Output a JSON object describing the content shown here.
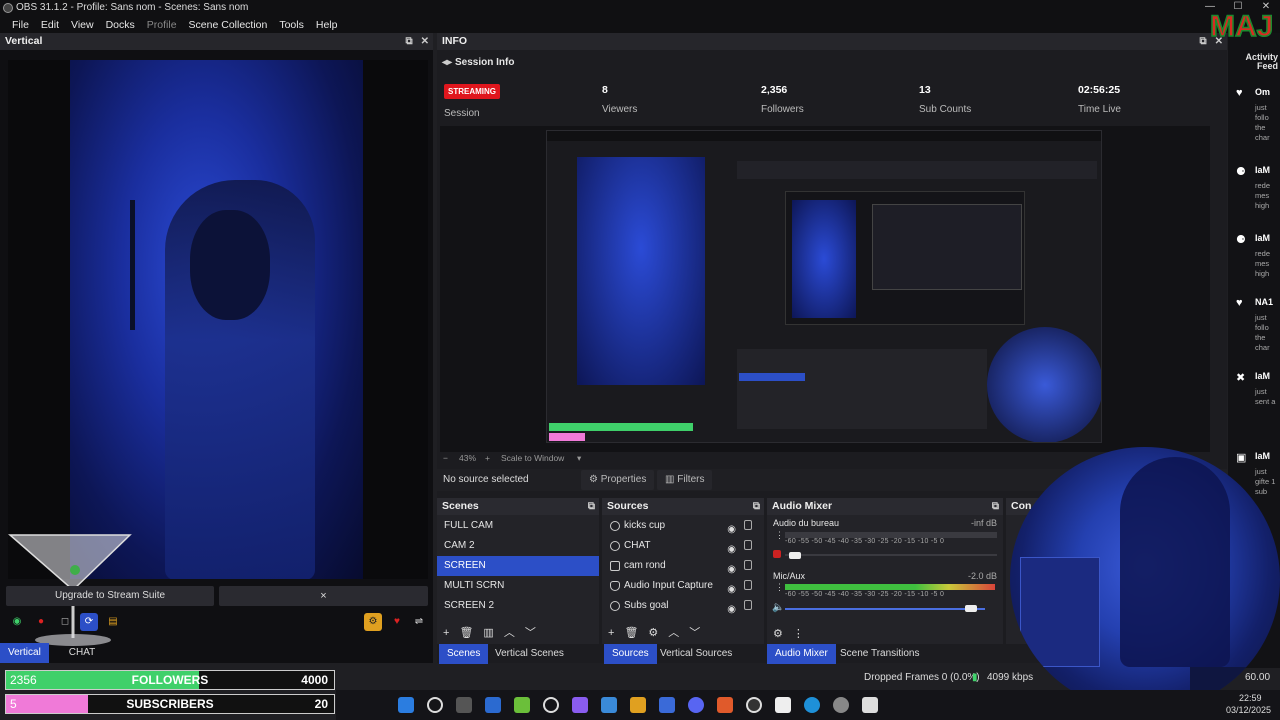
{
  "window": {
    "title": "OBS 31.1.2 - Profile: Sans nom - Scenes: Sans nom"
  },
  "menu": [
    "File",
    "Edit",
    "View",
    "Docks",
    "Profile",
    "Scene Collection",
    "Tools",
    "Help"
  ],
  "vertical": {
    "title": "Vertical",
    "upgrade_label": "Upgrade to Stream Suite",
    "close_label": "×",
    "tabs": [
      "Vertical",
      "CHAT"
    ]
  },
  "info": {
    "title": "INFO",
    "session_info": "Session Info",
    "status_badge": "STREAMING",
    "session_label": "Session",
    "stats": [
      {
        "value": "8",
        "label": "Viewers"
      },
      {
        "value": "2,356",
        "label": "Followers"
      },
      {
        "value": "13",
        "label": "Sub Counts"
      },
      {
        "value": "02:56:25",
        "label": "Time Live"
      }
    ]
  },
  "preview": {
    "zoom": "43%",
    "scale_label": "Scale to Window",
    "no_source": "No source selected",
    "properties_label": "Properties",
    "filters_label": "Filters"
  },
  "scenes": {
    "title": "Scenes",
    "items": [
      "FULL CAM",
      "CAM 2",
      "SCREEN",
      "MULTI SCRN",
      "SCREEN 2"
    ],
    "selected": "SCREEN"
  },
  "sources": {
    "title": "Sources",
    "items": [
      "kicks cup",
      "CHAT",
      "cam rond",
      "Audio Input Capture",
      "Subs goal"
    ]
  },
  "audio": {
    "title": "Audio Mixer",
    "channels": [
      {
        "name": "Audio du bureau",
        "db": "-inf dB",
        "level": 0.0
      },
      {
        "name": "Mic/Aux",
        "db": "-2.0 dB",
        "level": 0.98
      }
    ],
    "ticks": "-60 -55 -50 -45 -40 -35 -30 -25 -20 -15 -10 -5 0"
  },
  "controls_title": "Con",
  "dock_tabs": {
    "scenes": [
      "Scenes",
      "Vertical Scenes"
    ],
    "sources": [
      "Sources",
      "Vertical Sources"
    ],
    "audio": [
      "Audio Mixer",
      "Scene Transitions"
    ]
  },
  "status": {
    "dropped": "Dropped Frames 0 (0.0%)",
    "kbps": "4099 kbps",
    "fps": "60.00 FPS"
  },
  "goals": [
    {
      "current": "2356",
      "label": "FOLLOWERS",
      "target": "4000",
      "progress": 0.589,
      "color": "#3fd06a"
    },
    {
      "current": "5",
      "label": "SUBSCRIBERS",
      "target": "20",
      "progress": 0.25,
      "color": "#f07ad8"
    }
  ],
  "feed": {
    "title": "Activity Feed",
    "items": [
      {
        "icon": "♥",
        "name": "Om",
        "text": "just follo the char"
      },
      {
        "icon": "⚈",
        "name": "IaM",
        "text": "rede mes high"
      },
      {
        "icon": "⚈",
        "name": "IaM",
        "text": "rede mes high"
      },
      {
        "icon": "♥",
        "name": "NA1",
        "text": "just follo the char"
      },
      {
        "icon": "✖",
        "name": "IaM",
        "text": "just sent a"
      },
      {
        "icon": "▣",
        "name": "IaM",
        "text": "just gifte 1 sub"
      }
    ]
  },
  "clock": {
    "time": "22:59",
    "date": "03/12/2025"
  },
  "logo": "MAJ"
}
